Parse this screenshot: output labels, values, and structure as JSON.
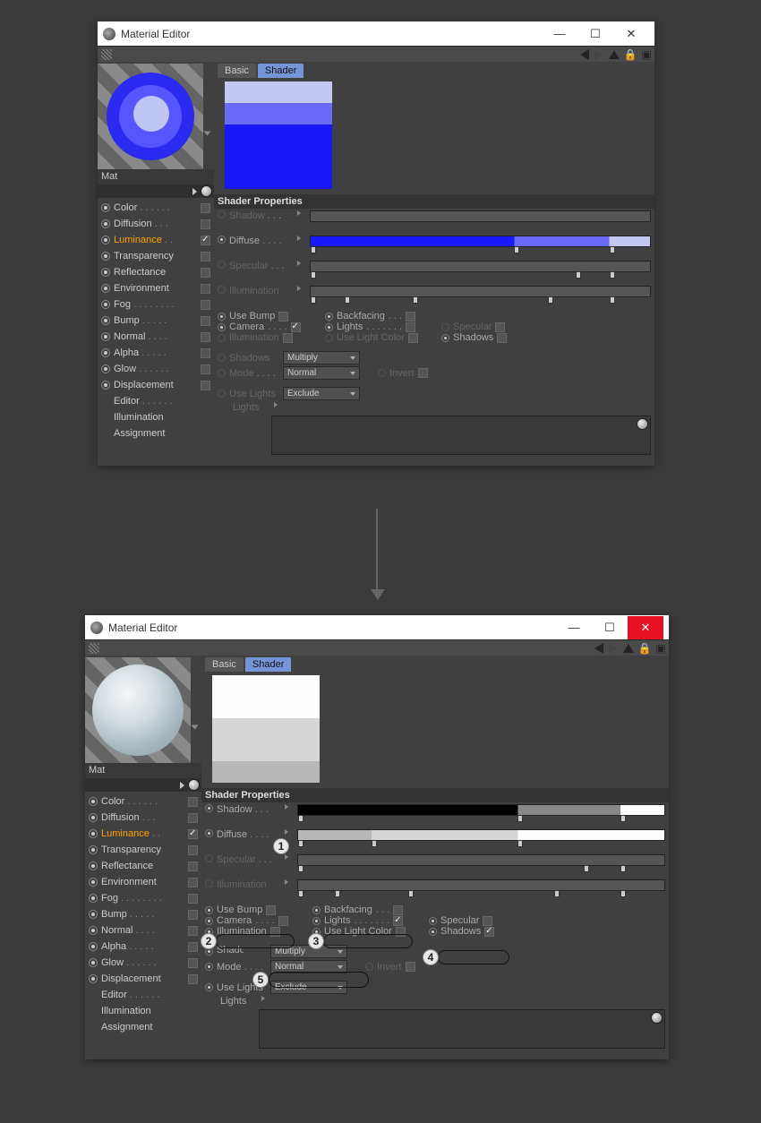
{
  "window_title": "Material Editor",
  "tabs": {
    "basic": "Basic",
    "shader": "Shader"
  },
  "material_name": "Mat",
  "section_header": "Shader Properties",
  "channels": [
    {
      "label": "Color",
      "dots": " . . . . . .",
      "radio": true,
      "check": false
    },
    {
      "label": "Diffusion",
      "dots": " . . .",
      "radio": true,
      "check": false
    },
    {
      "label": "Luminance",
      "dots": " . .",
      "radio": true,
      "check": true,
      "sel": true
    },
    {
      "label": "Transparency",
      "dots": "",
      "radio": true,
      "check": false
    },
    {
      "label": "Reflectance",
      "dots": "",
      "radio": true,
      "check": false
    },
    {
      "label": "Environment",
      "dots": "",
      "radio": true,
      "check": false
    },
    {
      "label": "Fog",
      "dots": " . . . . . . . .",
      "radio": true,
      "check": false
    },
    {
      "label": "Bump",
      "dots": " . . . . .",
      "radio": true,
      "check": false
    },
    {
      "label": "Normal",
      "dots": " . . . .",
      "radio": true,
      "check": false
    },
    {
      "label": "Alpha",
      "dots": " . . . . .",
      "radio": true,
      "check": false
    },
    {
      "label": "Glow",
      "dots": " . . . . . .",
      "radio": true,
      "check": false
    },
    {
      "label": "Displacement",
      "dots": "",
      "radio": true,
      "check": false
    }
  ],
  "sub_channels": [
    "Editor",
    "Illumination",
    "Assignment"
  ],
  "props": {
    "shadow": "Shadow",
    "diffuse": "Diffuse",
    "specular": "Specular",
    "illumination": "Illumination",
    "use_bump": "Use Bump",
    "backfacing": "Backfacing",
    "camera": "Camera",
    "lights": "Lights",
    "specular2": "Specular",
    "illum2": "Illumination",
    "use_light_color": "Use Light Color",
    "shadows2": "Shadows",
    "shadows_mode": "Shadows",
    "mode": "Mode",
    "invert": "Invert",
    "use_lights": "Use Lights",
    "lights_list": "Lights"
  },
  "dropdowns": {
    "multiply": "Multiply",
    "normal": "Normal",
    "exclude": "Exclude"
  },
  "top": {
    "camera_checked": true,
    "lights_checked": false,
    "shadows_checked": false,
    "shadow_enabled": false,
    "diffuse_enabled": true,
    "specular_enabled": false,
    "illum_enabled": false,
    "close_highlight": false
  },
  "bottom": {
    "camera_checked": false,
    "lights_checked": true,
    "shadows_checked": true,
    "shadow_enabled": true,
    "diffuse_enabled": true,
    "specular_enabled": false,
    "illum_enabled": false,
    "close_highlight": true
  },
  "callouts": {
    "1": "1",
    "2": "2",
    "3": "3",
    "4": "4",
    "5": "5"
  },
  "sub_dots": {
    "editor": " . . . . . .",
    "illum": "",
    "assign": ""
  }
}
